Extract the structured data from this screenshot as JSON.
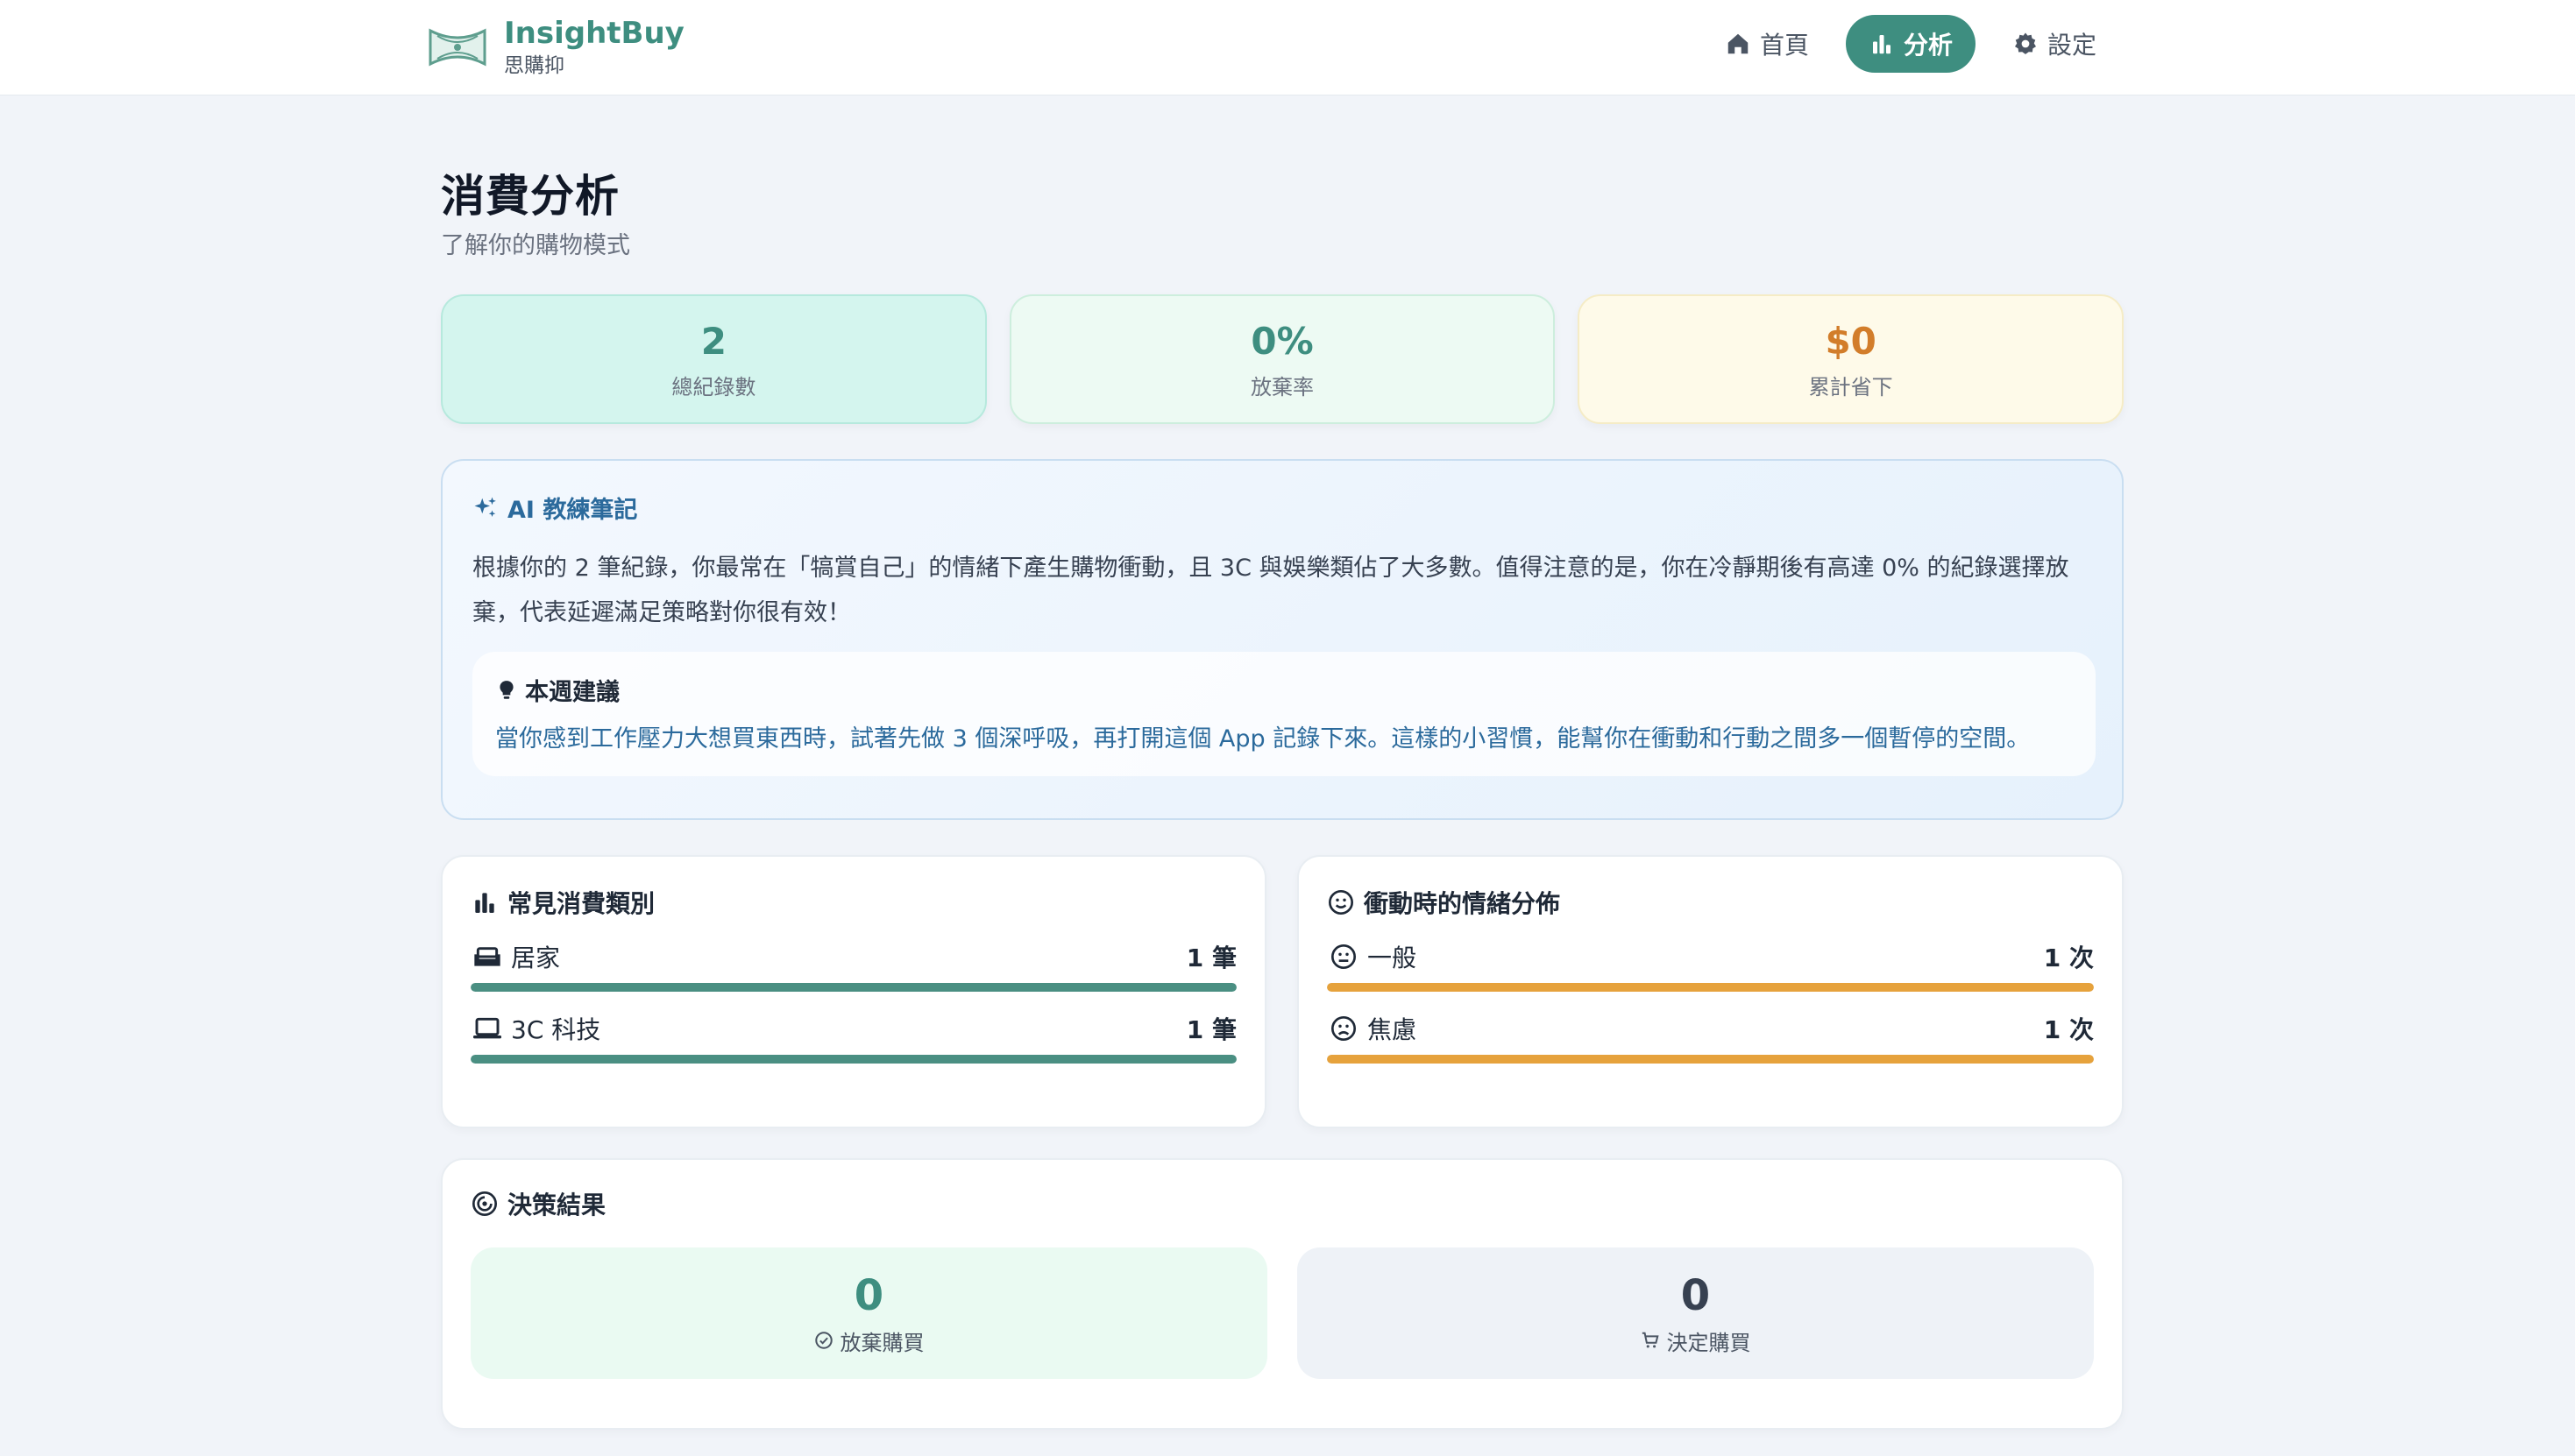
{
  "app": {
    "name": "InsightBuy",
    "subtitle": "思購抑"
  },
  "nav": {
    "items": [
      {
        "label": "首頁",
        "icon": "home-icon"
      },
      {
        "label": "分析",
        "icon": "bar-chart-icon",
        "active": true
      },
      {
        "label": "設定",
        "icon": "gear-icon"
      }
    ]
  },
  "page": {
    "title": "消費分析",
    "subtitle": "了解你的購物模式"
  },
  "stats": [
    {
      "value": "2",
      "label": "總紀錄數"
    },
    {
      "value": "0%",
      "label": "放棄率"
    },
    {
      "value": "$0",
      "label": "累計省下"
    }
  ],
  "ai_note": {
    "title": "AI 教練筆記",
    "body": "根據你的 2 筆紀錄，你最常在「犒賞自己」的情緒下產生購物衝動，且 3C 與娛樂類佔了大多數。值得注意的是，你在冷靜期後有高達 0% 的紀錄選擇放棄，代表延遲滿足策略對你很有效！",
    "tip_title": "本週建議",
    "tip_text": "當你感到工作壓力大想買東西時，試著先做 3 個深呼吸，再打開這個 App 記錄下來。這樣的小習慣，能幫你在衝動和行動之間多一個暫停的空間。"
  },
  "categories": {
    "title": "常見消費類別",
    "items": [
      {
        "label": "居家",
        "count": "1 筆",
        "icon": "sofa-icon",
        "fraction": 1.0
      },
      {
        "label": "3C 科技",
        "count": "1 筆",
        "icon": "laptop-icon",
        "fraction": 1.0
      }
    ]
  },
  "emotions": {
    "title": "衝動時的情緒分佈",
    "items": [
      {
        "label": "一般",
        "count": "1 次",
        "icon": "neutral-face-icon",
        "fraction": 1.0
      },
      {
        "label": "焦慮",
        "count": "1 次",
        "icon": "sad-face-icon",
        "fraction": 1.0
      }
    ]
  },
  "decisions": {
    "title": "決策結果",
    "give_up": {
      "value": "0",
      "label": "放棄購買"
    },
    "buy": {
      "value": "0",
      "label": "決定購買"
    }
  },
  "colors": {
    "accent": "#3e8e80",
    "bar_green": "#4a8f82",
    "bar_orange": "#e6a23c",
    "savings": "#d27d2a",
    "ai_blue": "#2b6a9c"
  }
}
